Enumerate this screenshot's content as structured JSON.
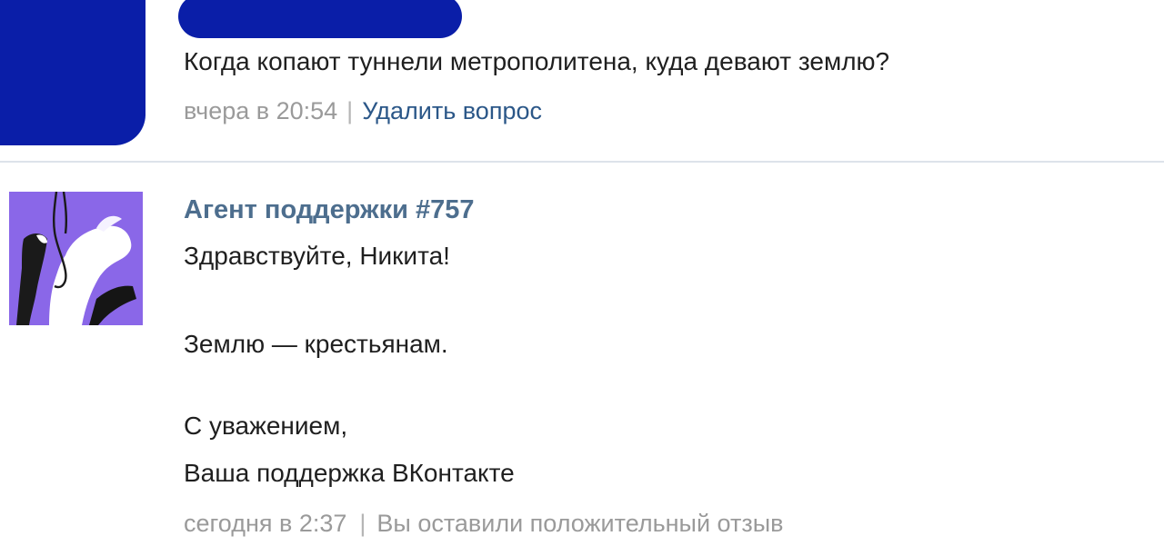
{
  "question": {
    "text": "Когда копают туннели метрополитена, куда девают землю?",
    "time": "вчера в 20:54",
    "separator": "|",
    "delete_link": "Удалить вопрос"
  },
  "answer": {
    "agent_name": "Агент поддержки #757",
    "lines": [
      "Здравствуйте, Никита!",
      "Землю — крестьянам.",
      "С уважением,",
      "Ваша поддержка ВКонтакте"
    ],
    "time": "сегодня в 2:37",
    "separator": "|",
    "feedback": "Вы оставили положительный отзыв"
  },
  "colors": {
    "redaction": "#0a1ea8",
    "agent_name": "#4d6e8e",
    "link": "#2b5788",
    "meta_gray": "#9a9a9a",
    "avatar_background": "#8a67e8"
  },
  "icons": {
    "agent_avatar": "support-agent-avatar-icon"
  }
}
